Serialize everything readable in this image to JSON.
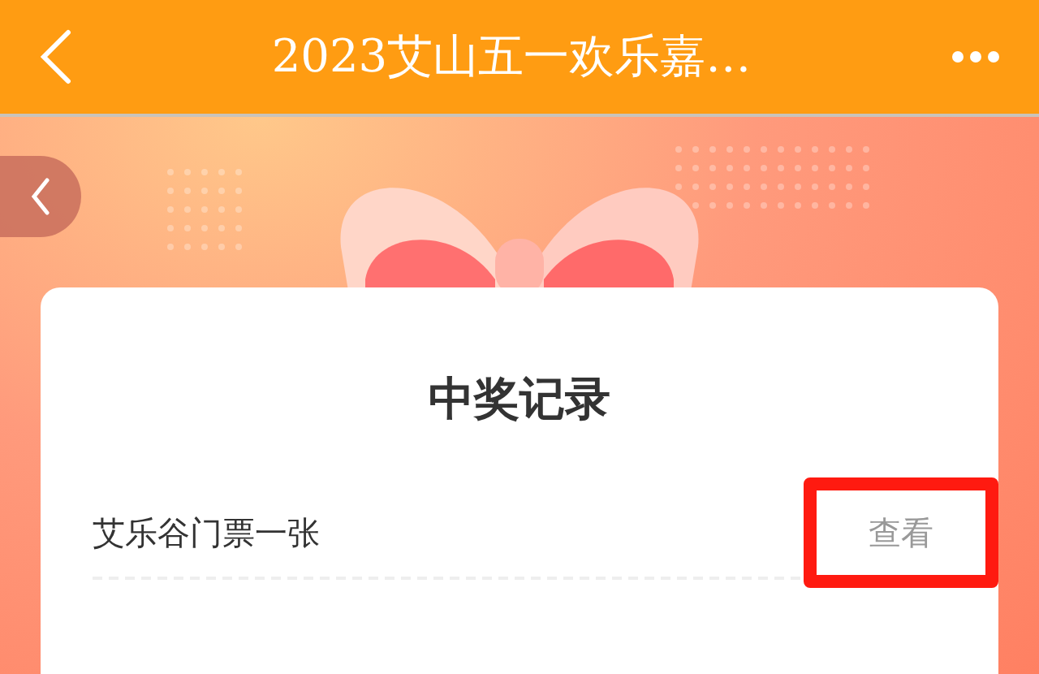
{
  "header": {
    "title": "2023艾山五一欢乐嘉…"
  },
  "card": {
    "title": "中奖记录",
    "records": [
      {
        "prize": "艾乐谷门票一张",
        "action": "查看",
        "highlighted": true
      }
    ]
  }
}
